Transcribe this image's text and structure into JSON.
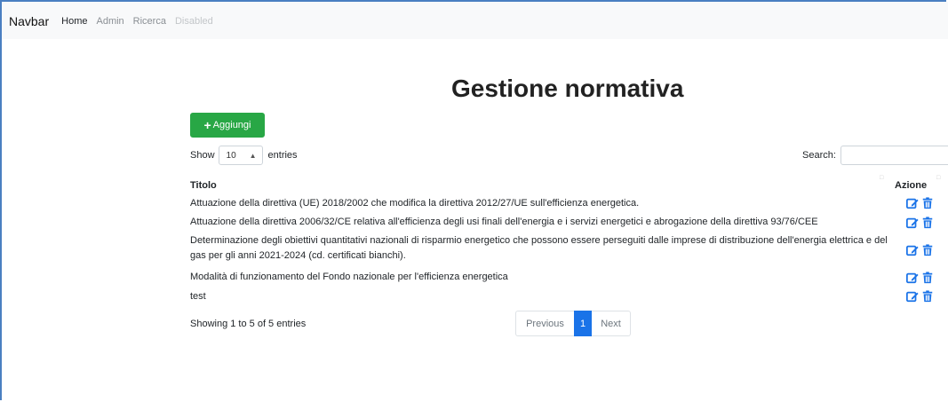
{
  "navbar": {
    "brand": "Navbar",
    "links": [
      "Home",
      "Admin",
      "Ricerca",
      "Disabled"
    ]
  },
  "page": {
    "title": "Gestione normativa",
    "add_button": {
      "icon": "plus-icon",
      "label": "Aggiungi"
    }
  },
  "table": {
    "length": {
      "prefix": "Show",
      "value": "10",
      "suffix": "entries"
    },
    "search": {
      "label": "Search:",
      "value": ""
    },
    "headers": {
      "title": "Titolo",
      "action": "Azione"
    },
    "rows": [
      {
        "title": "Attuazione della direttiva (UE) 2018/2002 che modifica la direttiva 2012/27/UE sull'efficienza energetica."
      },
      {
        "title": "Attuazione della direttiva 2006/32/CE relativa all'efficienza degli usi finali dell'energia e i servizi energetici e abrogazione della direttiva 93/76/CEE"
      },
      {
        "title": "Determinazione degli obiettivi quantitativi nazionali di risparmio energetico che possono essere perseguiti dalle imprese di distribuzione dell'energia elettrica e del gas per gli anni 2021-2024 (cd. certificati bianchi)."
      },
      {
        "title": "Modalità di funzionamento del Fondo nazionale per l'efficienza energetica"
      },
      {
        "title": "test"
      }
    ],
    "row_actions": [
      "edit-icon",
      "trash-icon"
    ],
    "info": "Showing 1 to 5 of 5 entries",
    "pagination": {
      "previous": "Previous",
      "current": "1",
      "next": "Next"
    }
  },
  "colors": {
    "add_button": "#28a745",
    "action_icons": "#1a73e8",
    "active_page": "#1a73e8",
    "navbar_bg": "#f8f9fa"
  }
}
